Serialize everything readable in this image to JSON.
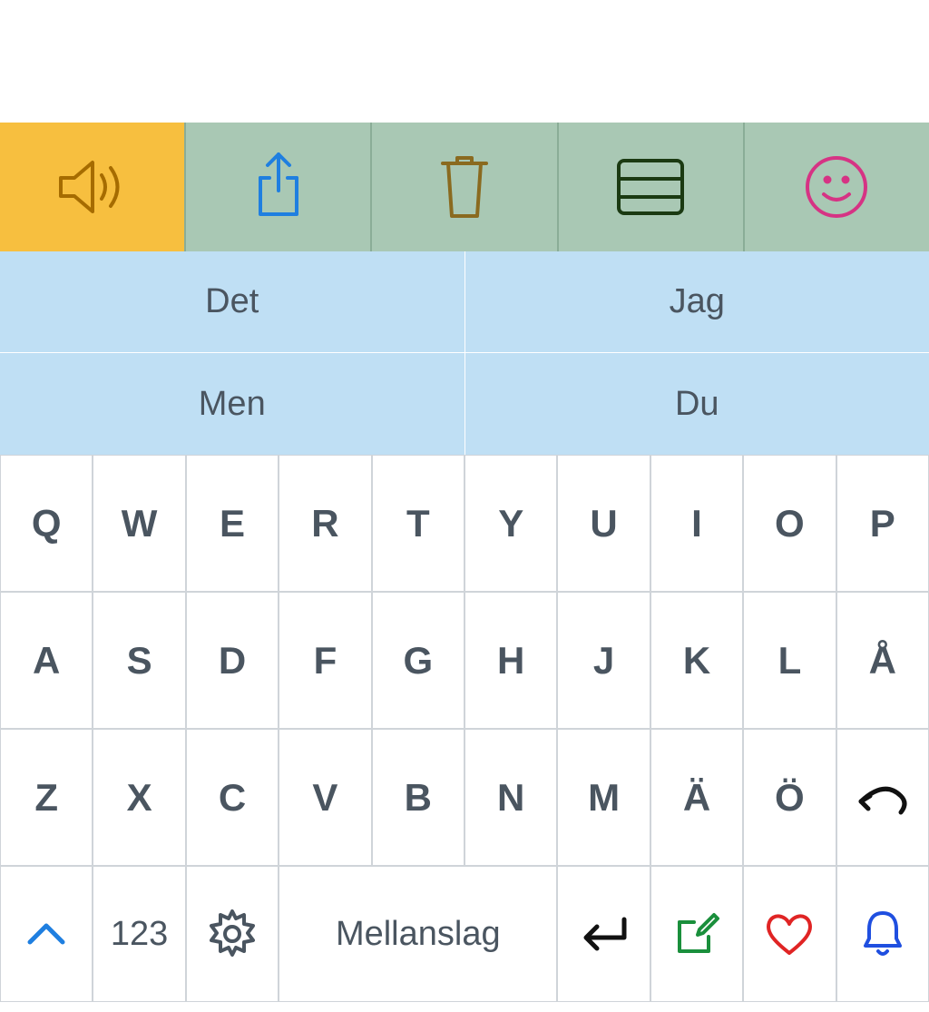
{
  "toolbar": {
    "items": [
      "speaker",
      "share",
      "trash",
      "rows",
      "smile"
    ]
  },
  "suggestions": {
    "row1": [
      "Det",
      "Jag"
    ],
    "row2": [
      "Men",
      "Du"
    ]
  },
  "keyboard": {
    "row1": [
      "Q",
      "W",
      "E",
      "R",
      "T",
      "Y",
      "U",
      "I",
      "O",
      "P"
    ],
    "row2": [
      "A",
      "S",
      "D",
      "F",
      "G",
      "H",
      "J",
      "K",
      "L",
      "Å"
    ],
    "row3": [
      "Z",
      "X",
      "C",
      "V",
      "B",
      "N",
      "M",
      "Ä",
      "Ö",
      "undo"
    ]
  },
  "bottom": {
    "shift_label": "",
    "numbers_label": "123",
    "space_label": "Mellanslag"
  }
}
